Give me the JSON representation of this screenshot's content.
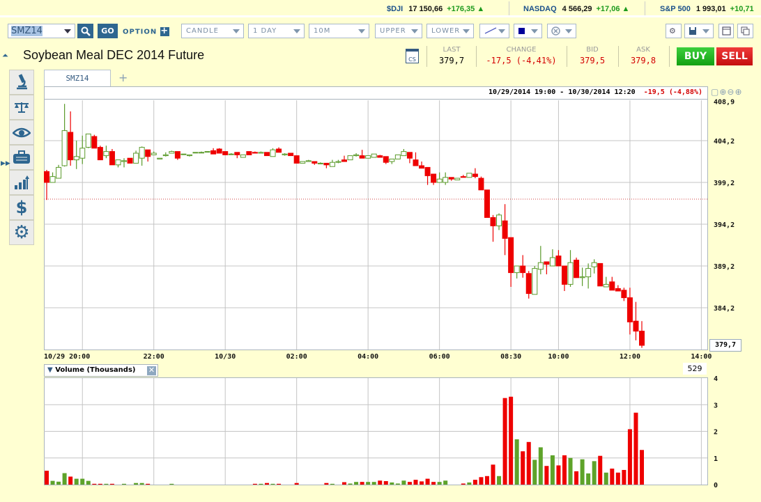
{
  "ticker": [
    {
      "symbol": "$DJI",
      "value": "17 150,66",
      "change": "+176,35",
      "dir": "up"
    },
    {
      "symbol": "NASDAQ",
      "value": "4 566,29",
      "change": "+17,06",
      "dir": "up"
    },
    {
      "symbol": "S&P 500",
      "value": "1 993,01",
      "change": "+10,71",
      "dir": "up"
    }
  ],
  "toolbar": {
    "symbol_value": "SMZ14",
    "go": "GO",
    "option": "OPTION",
    "chart_type": "CANDLE",
    "period": "1 DAY",
    "interval": "10M",
    "upper": "UPPER",
    "lower": "LOWER"
  },
  "instrument": {
    "title": "Soybean Meal DEC 2014 Future",
    "cs": "CS"
  },
  "quote": {
    "last_label": "LAST",
    "last": "379,7",
    "change_label": "CHANGE",
    "change": "-17,5 (-4,41%)",
    "bid_label": "BID",
    "bid": "379,5",
    "ask_label": "ASK",
    "ask": "379,8",
    "buy": "BUY",
    "sell": "SELL"
  },
  "tab": {
    "label": "SMZ14",
    "add": "+"
  },
  "colors": {
    "up": "#5a9a2a",
    "down": "#ee0000",
    "accent": "#2e6690"
  },
  "chart_data": {
    "type": "candlestick",
    "range_label": "10/29/2014 19:00 - 10/30/2014 12:20",
    "range_change": "-19,5 (-4,88%)",
    "interval_minutes": 10,
    "y_ticks": [
      "408,9",
      "404,2",
      "399,2",
      "394,2",
      "389,2",
      "384,2"
    ],
    "y_tick_values": [
      408.9,
      404.2,
      399.2,
      394.2,
      389.2,
      384.2
    ],
    "last_price_label": "379,7",
    "last_price": 379.7,
    "prev_close": 397.2,
    "x_ticks": [
      {
        "label": "10/29  20:00",
        "index": 6
      },
      {
        "label": "22:00",
        "index": 18
      },
      {
        "label": "10/30",
        "index": 30
      },
      {
        "label": "02:00",
        "index": 42
      },
      {
        "label": "04:00",
        "index": 54
      },
      {
        "label": "06:00",
        "index": 66
      },
      {
        "label": "08:30",
        "index": 78
      },
      {
        "label": "10:00",
        "index": 86
      },
      {
        "label": "12:00",
        "index": 98
      },
      {
        "label": "14:00",
        "index": 110
      }
    ],
    "ohlc": [
      [
        400.5,
        400.7,
        397.1,
        399.2
      ],
      [
        399.2,
        400.4,
        399.2,
        399.9
      ],
      [
        399.7,
        401.3,
        399.7,
        401.0
      ],
      [
        401.2,
        408.6,
        401.1,
        405.4
      ],
      [
        405.2,
        407.7,
        401.2,
        401.9
      ],
      [
        401.9,
        404.2,
        400.8,
        402.3
      ],
      [
        402.1,
        404.8,
        401.4,
        403.3
      ],
      [
        403.4,
        405.0,
        403.3,
        405.0
      ],
      [
        404.7,
        404.9,
        403.3,
        403.3
      ],
      [
        403.4,
        403.6,
        401.9,
        401.9
      ],
      [
        402.4,
        403.6,
        402.1,
        402.9
      ],
      [
        402.9,
        403.2,
        401.3,
        401.3
      ],
      [
        401.3,
        401.9,
        401.0,
        401.9
      ],
      [
        401.7,
        402.1,
        401.0,
        401.8
      ],
      [
        402.1,
        402.1,
        401.5,
        401.5
      ],
      [
        401.5,
        403.0,
        401.5,
        402.7
      ],
      [
        402.1,
        403.5,
        401.2,
        403.4
      ],
      [
        403.1,
        403.1,
        401.7,
        402.3
      ],
      [
        402.5,
        402.9,
        402.5,
        402.7
      ],
      [
        402.0,
        402.1,
        402.0,
        402.1
      ],
      [
        402.4,
        402.8,
        402.3,
        402.5
      ],
      [
        402.7,
        403.0,
        402.7,
        402.9
      ],
      [
        402.9,
        402.9,
        401.9,
        402.1
      ],
      [
        402.6,
        402.6,
        402.5,
        402.6
      ],
      [
        402.4,
        402.5,
        402.3,
        402.5
      ],
      [
        402.8,
        402.8,
        402.8,
        402.8
      ],
      [
        402.8,
        402.9,
        402.8,
        402.8
      ],
      [
        402.9,
        402.9,
        402.9,
        402.9
      ],
      [
        403.0,
        403.3,
        402.6,
        402.6
      ],
      [
        403.2,
        403.3,
        402.7,
        402.7
      ],
      [
        402.9,
        402.9,
        402.5,
        402.5
      ],
      [
        402.6,
        402.7,
        402.6,
        402.6
      ],
      [
        402.8,
        402.8,
        402.1,
        402.5
      ],
      [
        402.2,
        402.5,
        402.2,
        402.5
      ],
      [
        402.9,
        402.9,
        402.5,
        402.5
      ],
      [
        402.8,
        402.9,
        402.7,
        402.7
      ],
      [
        402.7,
        402.9,
        402.7,
        402.8
      ],
      [
        402.8,
        402.8,
        402.4,
        402.4
      ],
      [
        402.3,
        403.3,
        402.3,
        403.1
      ],
      [
        403.2,
        403.4,
        402.8,
        402.8
      ],
      [
        402.5,
        402.7,
        402.4,
        402.6
      ],
      [
        402.7,
        402.7,
        402.4,
        402.4
      ],
      [
        402.4,
        402.4,
        401.5,
        401.5
      ],
      [
        401.5,
        401.7,
        401.5,
        401.7
      ],
      [
        401.7,
        401.9,
        401.7,
        401.8
      ],
      [
        401.7,
        401.7,
        401.3,
        401.5
      ],
      [
        401.5,
        401.6,
        401.5,
        401.5
      ],
      [
        401.5,
        401.5,
        400.9,
        401.3
      ],
      [
        401.1,
        401.9,
        401.1,
        401.6
      ],
      [
        401.6,
        401.9,
        401.5,
        401.7
      ],
      [
        401.9,
        402.4,
        401.7,
        401.7
      ],
      [
        401.9,
        402.4,
        401.9,
        402.4
      ],
      [
        402.4,
        402.7,
        402.3,
        402.5
      ],
      [
        402.4,
        403.1,
        402.1,
        402.1
      ],
      [
        402.1,
        402.4,
        402.1,
        402.4
      ],
      [
        402.2,
        402.6,
        402.2,
        402.6
      ],
      [
        402.4,
        402.5,
        402.2,
        402.2
      ],
      [
        402.3,
        402.3,
        401.4,
        401.6
      ],
      [
        401.7,
        402.0,
        401.4,
        402.0
      ],
      [
        402.0,
        402.5,
        402.0,
        402.5
      ],
      [
        402.4,
        403.2,
        402.4,
        402.9
      ],
      [
        402.8,
        402.8,
        401.5,
        402.1
      ],
      [
        401.9,
        402.8,
        401.2,
        401.2
      ],
      [
        401.2,
        401.7,
        400.9,
        400.9
      ],
      [
        401.0,
        401.0,
        398.9,
        400.0
      ],
      [
        400.2,
        400.2,
        398.9,
        399.2
      ],
      [
        399.2,
        400.4,
        399.2,
        399.6
      ],
      [
        399.2,
        400.4,
        398.9,
        399.8
      ],
      [
        399.8,
        399.8,
        399.4,
        399.6
      ],
      [
        399.5,
        399.7,
        399.5,
        399.7
      ],
      [
        399.9,
        400.1,
        399.8,
        399.8
      ],
      [
        399.8,
        400.3,
        399.8,
        400.3
      ],
      [
        400.2,
        400.9,
        399.7,
        399.9
      ],
      [
        399.7,
        399.9,
        398.3,
        398.3
      ],
      [
        398.3,
        398.3,
        395.0,
        395.0
      ],
      [
        395.0,
        395.3,
        392.1,
        394.0
      ],
      [
        394.0,
        395.5,
        393.5,
        395.3
      ],
      [
        394.6,
        396.6,
        390.5,
        392.5
      ],
      [
        392.6,
        392.6,
        386.7,
        388.4
      ],
      [
        388.4,
        389.2,
        387.7,
        389.2
      ],
      [
        389.2,
        390.5,
        387.8,
        388.4
      ],
      [
        388.3,
        388.6,
        385.3,
        385.9
      ],
      [
        385.8,
        389.2,
        385.8,
        388.9
      ],
      [
        388.8,
        391.6,
        388.2,
        389.6
      ],
      [
        389.7,
        389.7,
        388.2,
        389.4
      ],
      [
        389.2,
        391.2,
        389.2,
        390.2
      ],
      [
        390.4,
        391.1,
        389.2,
        389.2
      ],
      [
        389.2,
        389.2,
        386.2,
        387.0
      ],
      [
        387.0,
        391.1,
        386.7,
        389.6
      ],
      [
        389.9,
        390.2,
        387.8,
        387.8
      ],
      [
        387.8,
        389.0,
        386.8,
        387.9
      ],
      [
        387.9,
        389.5,
        386.5,
        388.9
      ],
      [
        389.1,
        390.0,
        388.3,
        389.6
      ],
      [
        389.5,
        389.5,
        386.8,
        386.8
      ],
      [
        386.7,
        387.9,
        386.7,
        387.0
      ],
      [
        387.3,
        387.9,
        386.3,
        386.3
      ],
      [
        386.5,
        386.9,
        386.2,
        386.2
      ],
      [
        386.3,
        386.6,
        385.0,
        385.4
      ],
      [
        385.4,
        386.6,
        381.0,
        382.5
      ],
      [
        382.6,
        384.9,
        380.3,
        381.4
      ],
      [
        381.4,
        382.6,
        379.4,
        379.7
      ]
    ],
    "volume": {
      "title": "Volume (Thousands)",
      "current": "529",
      "y_ticks": [
        "4",
        "3",
        "2",
        "1",
        "0"
      ],
      "y_tick_values": [
        4,
        3,
        2,
        1,
        0
      ],
      "values": [
        0.52,
        0.14,
        0.11,
        0.43,
        0.3,
        0.22,
        0.22,
        0.14,
        0.03,
        0.03,
        0.03,
        0.03,
        0,
        0.03,
        0,
        0.06,
        0.06,
        0.03,
        0,
        0,
        0,
        0.03,
        0,
        0,
        0,
        0,
        0,
        0,
        0,
        0,
        0,
        0,
        0,
        0,
        0,
        0.03,
        0.03,
        0.06,
        0.03,
        0.03,
        0,
        0,
        0.06,
        0,
        0,
        0,
        0,
        0.06,
        0.03,
        0,
        0.09,
        0.04,
        0.1,
        0.1,
        0.1,
        0.1,
        0.15,
        0.13,
        0.08,
        0.04,
        0.15,
        0.1,
        0.18,
        0.12,
        0.22,
        0.1,
        0.1,
        0.15,
        0,
        0,
        0.04,
        0.08,
        0.18,
        0.28,
        0.32,
        0.75,
        0.32,
        3.25,
        3.3,
        1.7,
        1.25,
        1.6,
        0.93,
        1.4,
        0.7,
        1.1,
        0.72,
        1.1,
        1.0,
        0.5,
        0.95,
        0.42,
        0.88,
        1.08,
        0.45,
        0.6,
        0.45,
        0.55,
        2.08,
        2.7,
        1.3
      ]
    }
  }
}
